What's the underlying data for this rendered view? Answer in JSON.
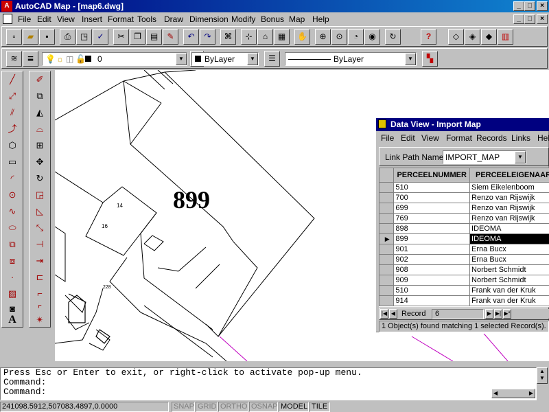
{
  "window": {
    "title": "AutoCAD Map - [map6.dwg]",
    "min": "_",
    "max": "□",
    "close": "×"
  },
  "menu": [
    "File",
    "Edit",
    "View",
    "Insert",
    "Format",
    "Tools",
    "Draw",
    "Dimension",
    "Modify",
    "Bonus",
    "Map",
    "Help"
  ],
  "layer_toolbar": {
    "layer_name": "0",
    "color": "ByLayer",
    "linetype": "ByLayer"
  },
  "drawing": {
    "parcel_label": "899",
    "small_labels": [
      "14",
      "16",
      "228"
    ]
  },
  "data_view": {
    "title": "Data View - Import Map",
    "menu": [
      "File",
      "Edit",
      "View",
      "Format",
      "Records",
      "Links",
      "Help"
    ],
    "link_path_label": "Link Path Name:",
    "link_path_value": "IMPORT_MAP",
    "columns": [
      "PERCEELNUMMER",
      "PERCEELEIGENAAR"
    ],
    "rows": [
      [
        "510",
        "Siem Eikelenboom"
      ],
      [
        "700",
        "Renzo van Rijswijk"
      ],
      [
        "699",
        "Renzo van Rijswijk"
      ],
      [
        "769",
        "Renzo van Rijswijk"
      ],
      [
        "898",
        "IDEOMA"
      ],
      [
        "899",
        "IDEOMA"
      ],
      [
        "901",
        "Erna Bucx"
      ],
      [
        "902",
        "Erna Bucx"
      ],
      [
        "908",
        "Norbert Schmidt"
      ],
      [
        "909",
        "Norbert Schmidt"
      ],
      [
        "510",
        "Frank van der Kruk"
      ],
      [
        "914",
        "Frank van der Kruk"
      ]
    ],
    "selected_row": 5,
    "record_label": "Record",
    "record_value": "6",
    "status": "1 Object(s) found matching 1 selected Record(s)."
  },
  "command": {
    "line1": "Press Esc or Enter to exit, or right-click to activate pop-up menu.",
    "line2": "Command:",
    "line3": "Command:"
  },
  "status_bar": {
    "coords": "241098.5912,507083.4897,0.0000",
    "snap": "SNAP",
    "grid": "GRID",
    "ortho": "ORTHO",
    "osnap": "OSNAP",
    "model": "MODEL",
    "tile": "TILE"
  }
}
